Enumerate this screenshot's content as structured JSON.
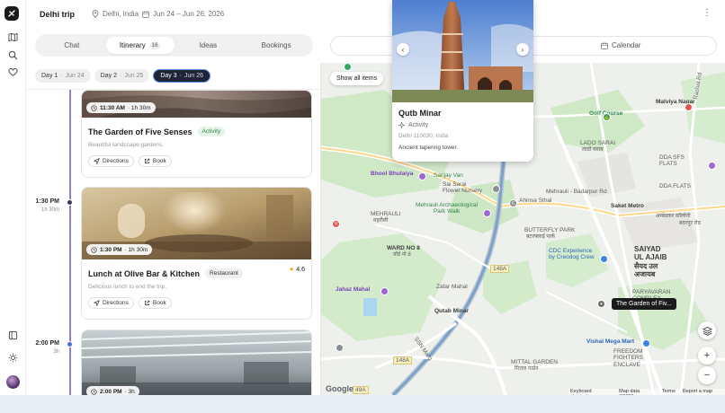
{
  "app": {
    "trip_title": "Delhi trip",
    "location": "Delhi, India",
    "dates": "Jun 24 – Jun 26, 2026"
  },
  "tabs": [
    {
      "label": "Chat",
      "count": ""
    },
    {
      "label": "Itinerary",
      "count": "16"
    },
    {
      "label": "Ideas",
      "count": ""
    },
    {
      "label": "Bookings",
      "count": ""
    }
  ],
  "active_tab": "Itinerary",
  "days": [
    {
      "label": "Day 1",
      "date": "Jun 24"
    },
    {
      "label": "Day 2",
      "date": "Jun 25"
    },
    {
      "label": "Day 3",
      "date": "Jun 26"
    }
  ],
  "active_day": "Day 3",
  "timeline": [
    {
      "time": "1:30 PM",
      "duration": "1h 30m"
    },
    {
      "time": "2:00 PM",
      "duration": "3h"
    }
  ],
  "cards": [
    {
      "time": "11:30 AM",
      "duration": "· 1h 30m",
      "title": "The Garden of Five Senses",
      "badge": "Activity",
      "description": "Beautiful landscape gardens.",
      "directions": "Directions",
      "book": "Book"
    },
    {
      "time": "1:30 PM",
      "duration": "· 1h 30m",
      "title": "Lunch at Olive Bar & Kitchen",
      "badge": "Restaurant",
      "rating": "4.6",
      "description": "Delicious lunch to end the trip.",
      "directions": "Directions",
      "book": "Book"
    },
    {
      "time": "2:00 PM",
      "duration": "· 3h"
    }
  ],
  "map": {
    "calendar_label": "Calendar",
    "show_all": "Show all items",
    "selected_marker": "The Garden of Fiv...",
    "google": "Google",
    "attribution": [
      "Keyboard shortcuts",
      "Map data ©2026",
      "Terms",
      "Report a map error"
    ],
    "labels": {
      "golf_course": "Golf Course",
      "malviya_nagar": "Malviya Nagar",
      "lado_sarai": "LADO SARAI",
      "lado_sarai_hi": "लाडो सराय",
      "dda_sfs_flats": "DDA SFS\nFLATS",
      "dda_flats": "DDA FLATS",
      "bhool_bhulaiya": "Bhool Bhulaiya",
      "sanjay_van": "Sanjay Van",
      "sai_sarai": "Sai Sarai\nFlower Nursery",
      "ahinsa_sthal": "Ahinsa Sthal",
      "mehrauli_badarpur": "Mehrauli - Badarpur Rd",
      "saket_metro": "Saket Metro",
      "mehrauli_park": "Mehrauli Archaeological\nPark Walk",
      "mehrauli": "MEHRAULI",
      "mehrauli_hi": "महरौली",
      "butterfly_park": "BUTTERFLY PARK",
      "butterfly_park_hi": "बटरफ्लाई पार्क",
      "ward_no_8": "WARD NO 8",
      "ward_no_8_hi": "वॉर्ड नो 8",
      "cdc_experience": "CDC Experience\nby Creodog Crew",
      "saiyad_ul_ajaib": "SAIYAD\nUL AJAIB",
      "saiyad_ul_ajaib_hi": "सैयद उल\nअजायब",
      "jahaz_mahal": "Jahaz Mahal",
      "zafar_mahal": "Zafar Mahal",
      "qutub_minar": "Qutab Minar",
      "paryavaran": "PARYAVARAN\nCOMPLEX",
      "vishal_mega_mart": "Vishal Mega Mart",
      "mittal_garden": "MITTAL GARDEN",
      "mittal_garden_hi": "मित्तल गार्डन",
      "freedom_fighters": "FREEDOM\nFIGHTERS\nENCLAVE",
      "ssn_marg": "SSN Marg",
      "ambedkar_colony": "अम्बेडकर कॉलोनी",
      "shahpur_badarpur": "बदरपुर रोड",
      "rashid_rd": "Rashid Rd",
      "sect_148a_1": "148A",
      "sect_148a_2": "148A",
      "road_4": "4",
      "road_49": "49A"
    }
  },
  "popup": {
    "title": "Qutb Minar",
    "type": "Activity",
    "address": "Delhi 110030, India",
    "description": "Ancient tapering tower."
  }
}
